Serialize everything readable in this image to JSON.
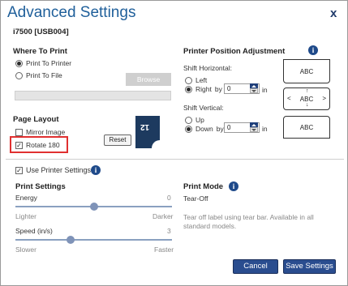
{
  "window": {
    "title": "Advanced Settings",
    "close_label": "x"
  },
  "printer": {
    "model": "i7500 [USB004]"
  },
  "where_to_print": {
    "heading": "Where To Print",
    "options": [
      "Print To Printer",
      "Print To File"
    ],
    "selected": "Print To Printer",
    "browse_label": "Browse",
    "path_value": ""
  },
  "page_layout": {
    "heading": "Page Layout",
    "mirror_label": "Mirror Image",
    "mirror_checked": false,
    "rotate_label": "Rotate 180",
    "rotate_checked": true,
    "reset_label": "Reset",
    "preview_text": "12"
  },
  "position": {
    "heading": "Printer Position Adjustment",
    "shift_h_label": "Shift Horizontal:",
    "left_label": "Left",
    "right_label": "Right",
    "by_label": "by",
    "h_value": "0",
    "unit": "in",
    "shift_v_label": "Shift Vertical:",
    "up_label": "Up",
    "down_label": "Down",
    "v_value": "0",
    "box_label": "ABC"
  },
  "use_printer_settings": {
    "label": "Use Printer Settings",
    "checked": true
  },
  "print_settings": {
    "heading": "Print Settings",
    "energy_label": "Energy",
    "energy_value": "0",
    "energy_min": "Lighter",
    "energy_max": "Darker",
    "energy_fraction": 0.5,
    "speed_label": "Speed (in/s)",
    "speed_value": "3",
    "speed_min": "Slower",
    "speed_max": "Faster",
    "speed_fraction": 0.35
  },
  "print_mode": {
    "heading": "Print Mode",
    "value": "Tear-Off",
    "description": "Tear off label using tear bar. Available in all standard models."
  },
  "buttons": {
    "cancel": "Cancel",
    "save": "Save Settings"
  },
  "colors": {
    "accent": "#2a4d8f",
    "title": "#1f5f9a",
    "highlight": "#e03030"
  }
}
